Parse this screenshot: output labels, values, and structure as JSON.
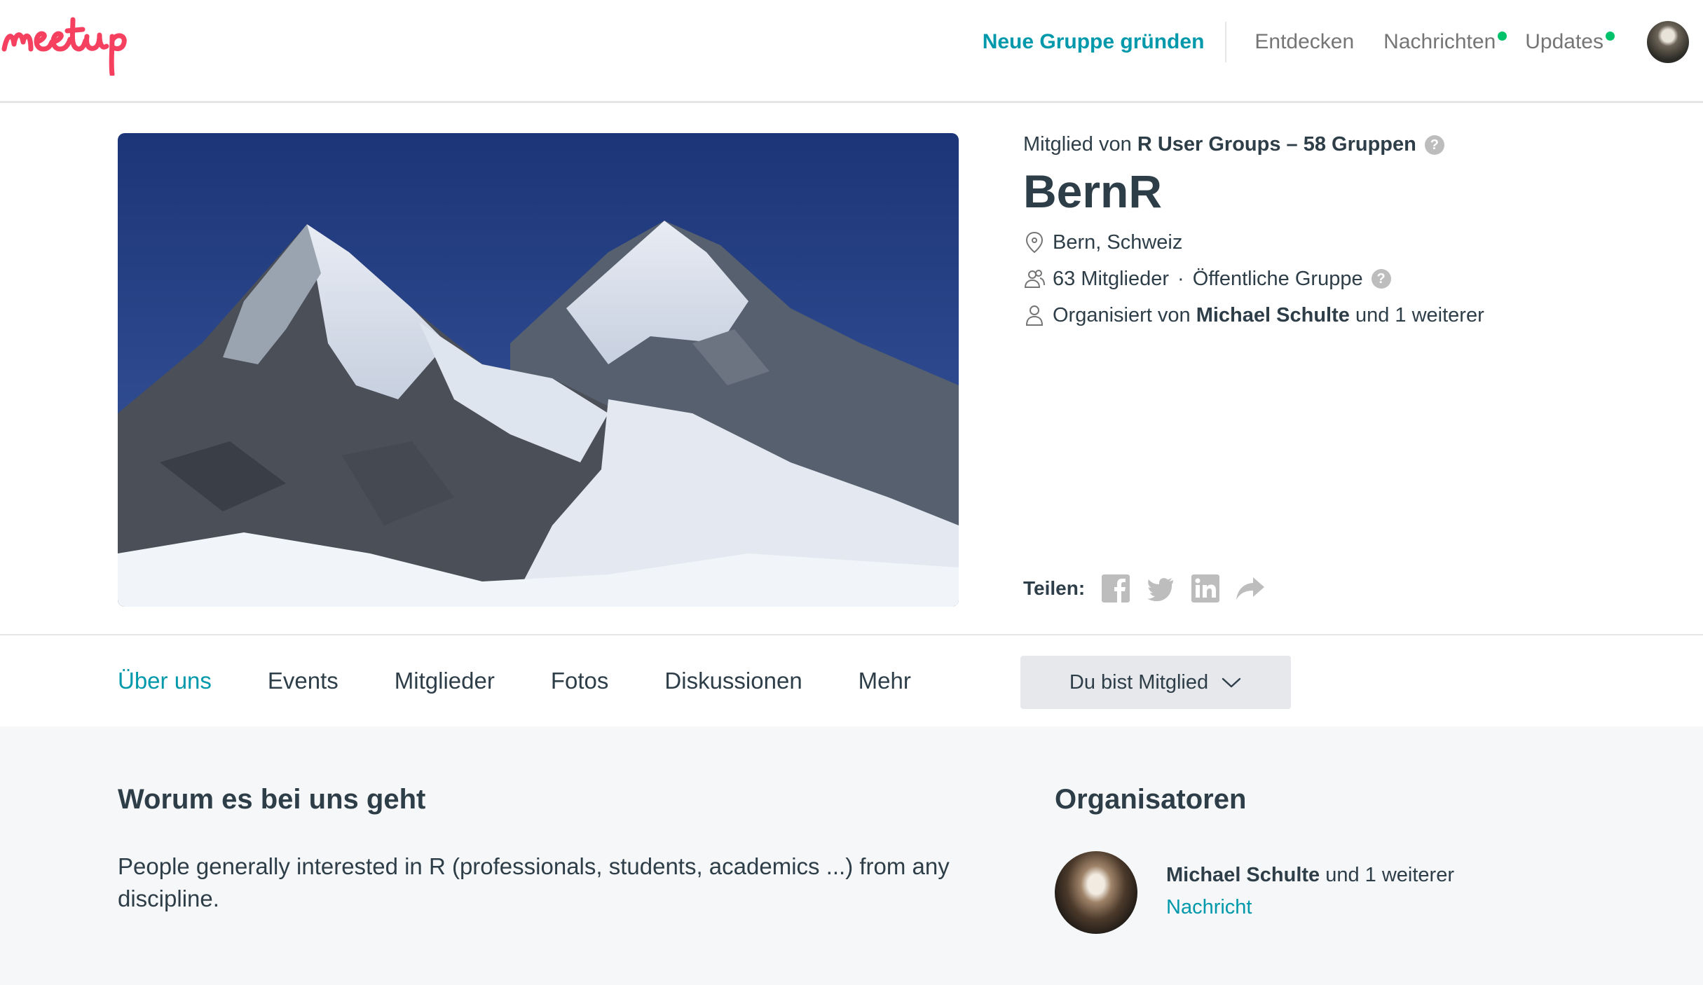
{
  "header": {
    "logo_text": "meetup",
    "create_group": "Neue Gruppe gründen",
    "nav": [
      {
        "label": "Entdecken",
        "dot": false
      },
      {
        "label": "Nachrichten",
        "dot": true
      },
      {
        "label": "Updates",
        "dot": true
      }
    ],
    "dot_color": "#00c26a"
  },
  "group": {
    "member_of_prefix": "Mitglied von",
    "member_of_network": "R User Groups – 58 Gruppen",
    "name": "BernR",
    "location": "Bern, Schweiz",
    "members": "63 Mitglieder",
    "separator": "·",
    "type": "Öffentliche Gruppe",
    "organized_prefix": "Organisiert von",
    "organizer": "Michael Schulte",
    "organized_suffix": "und 1 weiterer",
    "help_icon_text": "?"
  },
  "share": {
    "label": "Teilen:",
    "icons": [
      "facebook-icon",
      "twitter-icon",
      "linkedin-icon",
      "share-arrow-icon"
    ]
  },
  "tabs": {
    "items": [
      "Über uns",
      "Events",
      "Mitglieder",
      "Fotos",
      "Diskussionen",
      "Mehr"
    ],
    "active": "Über uns",
    "member_button": "Du bist Mitglied"
  },
  "about": {
    "title": "Worum es bei uns geht",
    "text": "People generally interested in R (professionals, students, academics ...) from any discipline."
  },
  "organizers": {
    "title": "Organisatoren",
    "name": "Michael Schulte",
    "suffix": "und 1 weiterer",
    "message": "Nachricht"
  },
  "colors": {
    "accent": "#0098ab",
    "brand": "#f64060",
    "text": "#2e3e48",
    "muted": "#757575"
  }
}
